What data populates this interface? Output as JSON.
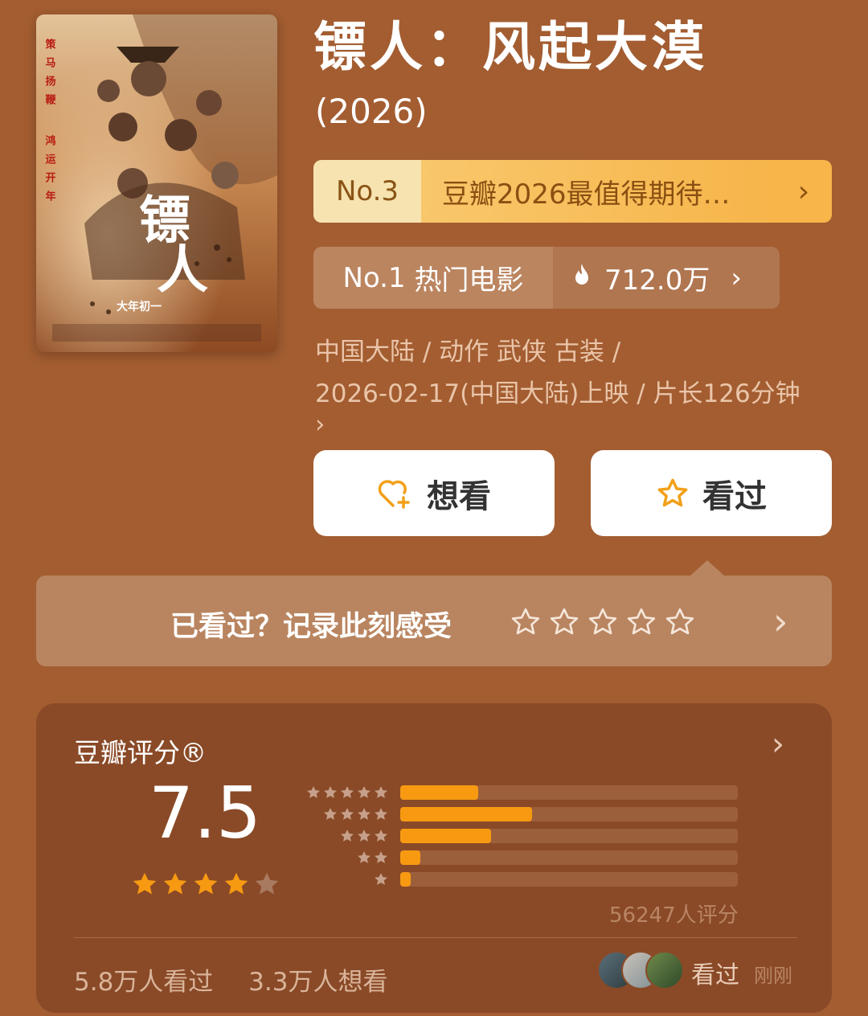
{
  "movie": {
    "title": "镖人：风起大漠",
    "year": "(2026)",
    "poster": {
      "title_chars": [
        "镖",
        "人"
      ],
      "side_lines": [
        "策马扬鞭",
        "鸿运开年"
      ],
      "release_tag": "大年初一"
    }
  },
  "rankings": [
    {
      "rank": "No.3",
      "label": "豆瓣2026最值得期待…",
      "chevron": "›"
    },
    {
      "rank": "No.1",
      "label": "热门电影",
      "heat": "712.0万",
      "chevron": "›"
    }
  ],
  "meta": {
    "line1": "中国大陆 / 动作 武侠 古装 /",
    "line2": "2026-02-17(中国大陆)上映 / 片长126分钟",
    "more": "›"
  },
  "actions": {
    "want": "想看",
    "seen": "看过"
  },
  "rate_prompt": {
    "text": "已看过？记录此刻感受",
    "chevron": "›"
  },
  "score": {
    "title": "豆瓣评分®",
    "value": "7.5",
    "star_rating": 4,
    "distribution": [
      {
        "stars": 5,
        "percent": 23
      },
      {
        "stars": 4,
        "percent": 39
      },
      {
        "stars": 3,
        "percent": 27
      },
      {
        "stars": 2,
        "percent": 6
      },
      {
        "stars": 1,
        "percent": 3
      }
    ],
    "count_text": "56247人评分",
    "seen_stat": "5.8万人看过",
    "want_stat": "3.3万人想看",
    "friends_action": "看过",
    "friends_time": "刚刚"
  },
  "colors": {
    "background": "#a35d31",
    "accent_orange": "#f79a12",
    "rank_gold": "#f7b54a",
    "card": "#8a4a27"
  },
  "icons": [
    "heart-plus-icon",
    "star-outline-icon",
    "fire-icon",
    "chevron-right-icon",
    "star-icon"
  ]
}
